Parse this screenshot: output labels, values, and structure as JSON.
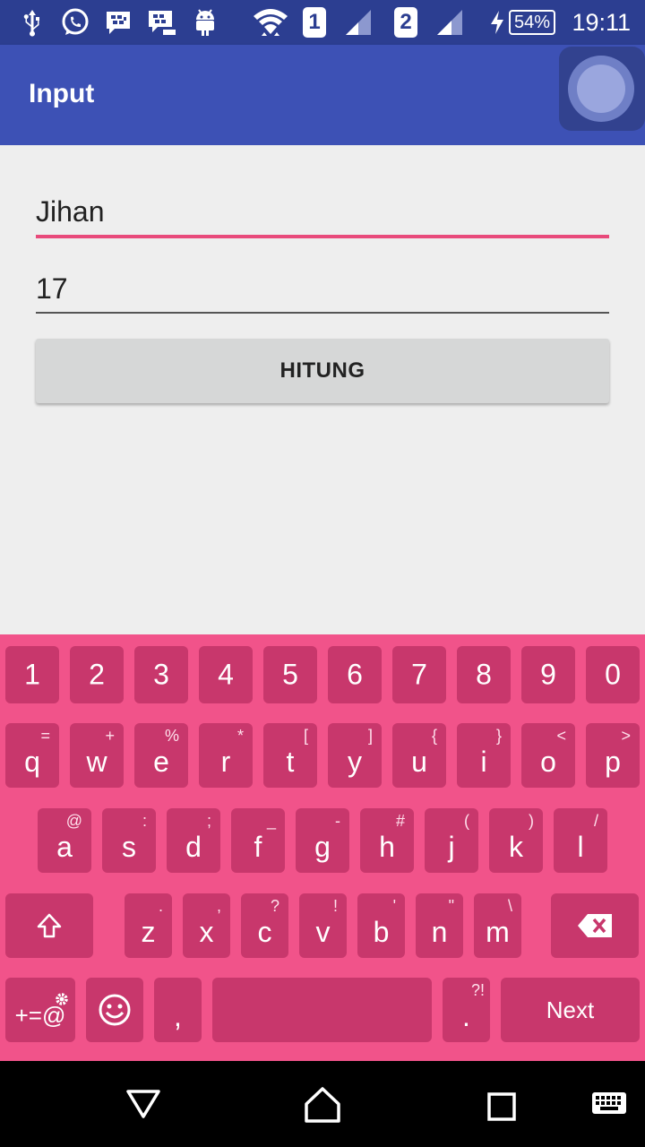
{
  "status_bar": {
    "sim1": "1",
    "sim2": "2",
    "battery": "54%",
    "time": "19:11"
  },
  "app_bar": {
    "title": "Input"
  },
  "form": {
    "name_value": "Jihan",
    "age_value": "17",
    "button_label": "HITUNG"
  },
  "keyboard": {
    "number_row": [
      "1",
      "2",
      "3",
      "4",
      "5",
      "6",
      "7",
      "8",
      "9",
      "0"
    ],
    "row1": [
      {
        "key": "q",
        "hint": "="
      },
      {
        "key": "w",
        "hint": "+"
      },
      {
        "key": "e",
        "hint": "%"
      },
      {
        "key": "r",
        "hint": "*"
      },
      {
        "key": "t",
        "hint": "["
      },
      {
        "key": "y",
        "hint": "]"
      },
      {
        "key": "u",
        "hint": "{"
      },
      {
        "key": "i",
        "hint": "}"
      },
      {
        "key": "o",
        "hint": "<"
      },
      {
        "key": "p",
        "hint": ">"
      }
    ],
    "row2": [
      {
        "key": "a",
        "hint": "@"
      },
      {
        "key": "s",
        "hint": ":"
      },
      {
        "key": "d",
        "hint": ";"
      },
      {
        "key": "f",
        "hint": "_"
      },
      {
        "key": "g",
        "hint": "-"
      },
      {
        "key": "h",
        "hint": "#"
      },
      {
        "key": "j",
        "hint": "("
      },
      {
        "key": "k",
        "hint": ")"
      },
      {
        "key": "l",
        "hint": "/"
      }
    ],
    "row3": [
      {
        "key": "z",
        "hint": "."
      },
      {
        "key": "x",
        "hint": ","
      },
      {
        "key": "c",
        "hint": "?"
      },
      {
        "key": "v",
        "hint": "!"
      },
      {
        "key": "b",
        "hint": "'"
      },
      {
        "key": "n",
        "hint": "\""
      },
      {
        "key": "m",
        "hint": "\\"
      }
    ],
    "symbols_label": "+=@",
    "comma_label": ",",
    "period_label": ".",
    "period_hint": "?!",
    "next_label": "Next"
  },
  "colors": {
    "app_bar": "#3d51b5",
    "status_bar": "#2c3e91",
    "accent": "#e84a7b",
    "keyboard_bg": "#f1538a",
    "key_bg": "#c8376c"
  },
  "icons": {
    "status": [
      "usb-icon",
      "whatsapp-icon",
      "bbm-icon",
      "bbm-chat-icon",
      "android-icon",
      "wifi-icon",
      "signal-icon",
      "charging-icon"
    ],
    "keyboard": [
      "shift-icon",
      "backspace-icon",
      "settings-icon",
      "emoji-icon"
    ],
    "nav": [
      "back-icon",
      "home-icon",
      "recents-icon",
      "keyboard-switch-icon"
    ]
  }
}
